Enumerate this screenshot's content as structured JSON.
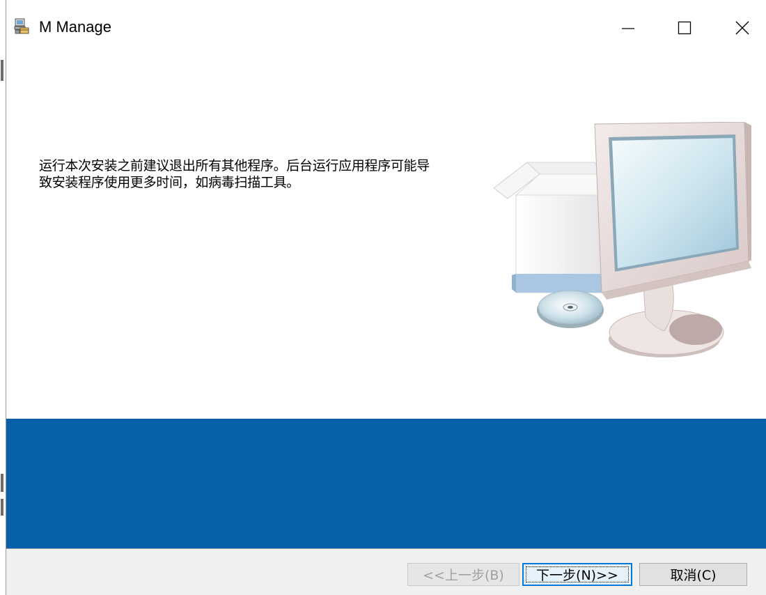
{
  "window": {
    "title": "M Manage",
    "app_icon": "installer-icon",
    "controls": {
      "minimize_icon": "minimize-icon",
      "maximize_icon": "maximize-icon",
      "close_icon": "close-icon"
    }
  },
  "content": {
    "message_line1": "运行本次安装之前建议退出所有其他程序。后台运行应用程序可能导",
    "message_line2": "致安装程序使用更多时间，如病毒扫描工具。",
    "illustration": "computer-setup-illustration"
  },
  "banner": {
    "color": "#0860a8"
  },
  "buttons": {
    "back_label": "<<上一步(B)",
    "next_label": "下一步(N)>>",
    "cancel_label": "取消(C)"
  }
}
